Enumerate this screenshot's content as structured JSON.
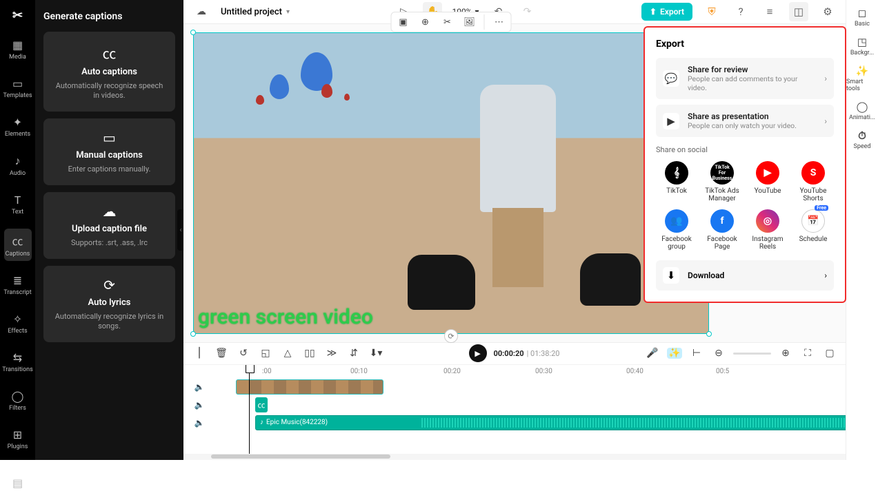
{
  "nav": {
    "items": [
      {
        "label": "Media"
      },
      {
        "label": "Templates"
      },
      {
        "label": "Elements"
      },
      {
        "label": "Audio"
      },
      {
        "label": "Text"
      },
      {
        "label": "Captions"
      },
      {
        "label": "Transcript"
      },
      {
        "label": "Effects"
      },
      {
        "label": "Transitions"
      },
      {
        "label": "Filters"
      },
      {
        "label": "Plugins"
      }
    ]
  },
  "side": {
    "title": "Generate captions",
    "cards": [
      {
        "title": "Auto captions",
        "desc": "Automatically recognize speech in videos."
      },
      {
        "title": "Manual captions",
        "desc": "Enter captions manually."
      },
      {
        "title": "Upload caption file",
        "desc": "Supports: .srt, .ass, .lrc"
      },
      {
        "title": "Auto lyrics",
        "desc": "Automatically recognize lyrics in songs."
      }
    ]
  },
  "toolbar": {
    "project": "Untitled project",
    "zoom": "100%",
    "export": "Export"
  },
  "rightrail": {
    "items": [
      "Basic",
      "Backgr...",
      "Smart tools",
      "Animati...",
      "Speed"
    ]
  },
  "canvas": {
    "ratio": "Ratio",
    "caption": "green screen video"
  },
  "timeline": {
    "current": "00:00:20",
    "duration": "01:38:20",
    "ticks": [
      ":00",
      "00:10",
      "00:20",
      "00:30",
      "00:40",
      "00:5"
    ],
    "audio_label": "Epic Music(842228)"
  },
  "export": {
    "title": "Export",
    "share_review": {
      "title": "Share for review",
      "desc": "People can add comments to your video."
    },
    "share_present": {
      "title": "Share as presentation",
      "desc": "People can only watch your video."
    },
    "social_title": "Share on social",
    "socials": [
      {
        "label": "TikTok"
      },
      {
        "label": "TikTok Ads Manager"
      },
      {
        "label": "YouTube"
      },
      {
        "label": "YouTube Shorts"
      },
      {
        "label": "Facebook group"
      },
      {
        "label": "Facebook Page"
      },
      {
        "label": "Instagram Reels"
      },
      {
        "label": "Schedule"
      }
    ],
    "free": "Free",
    "download": "Download"
  }
}
